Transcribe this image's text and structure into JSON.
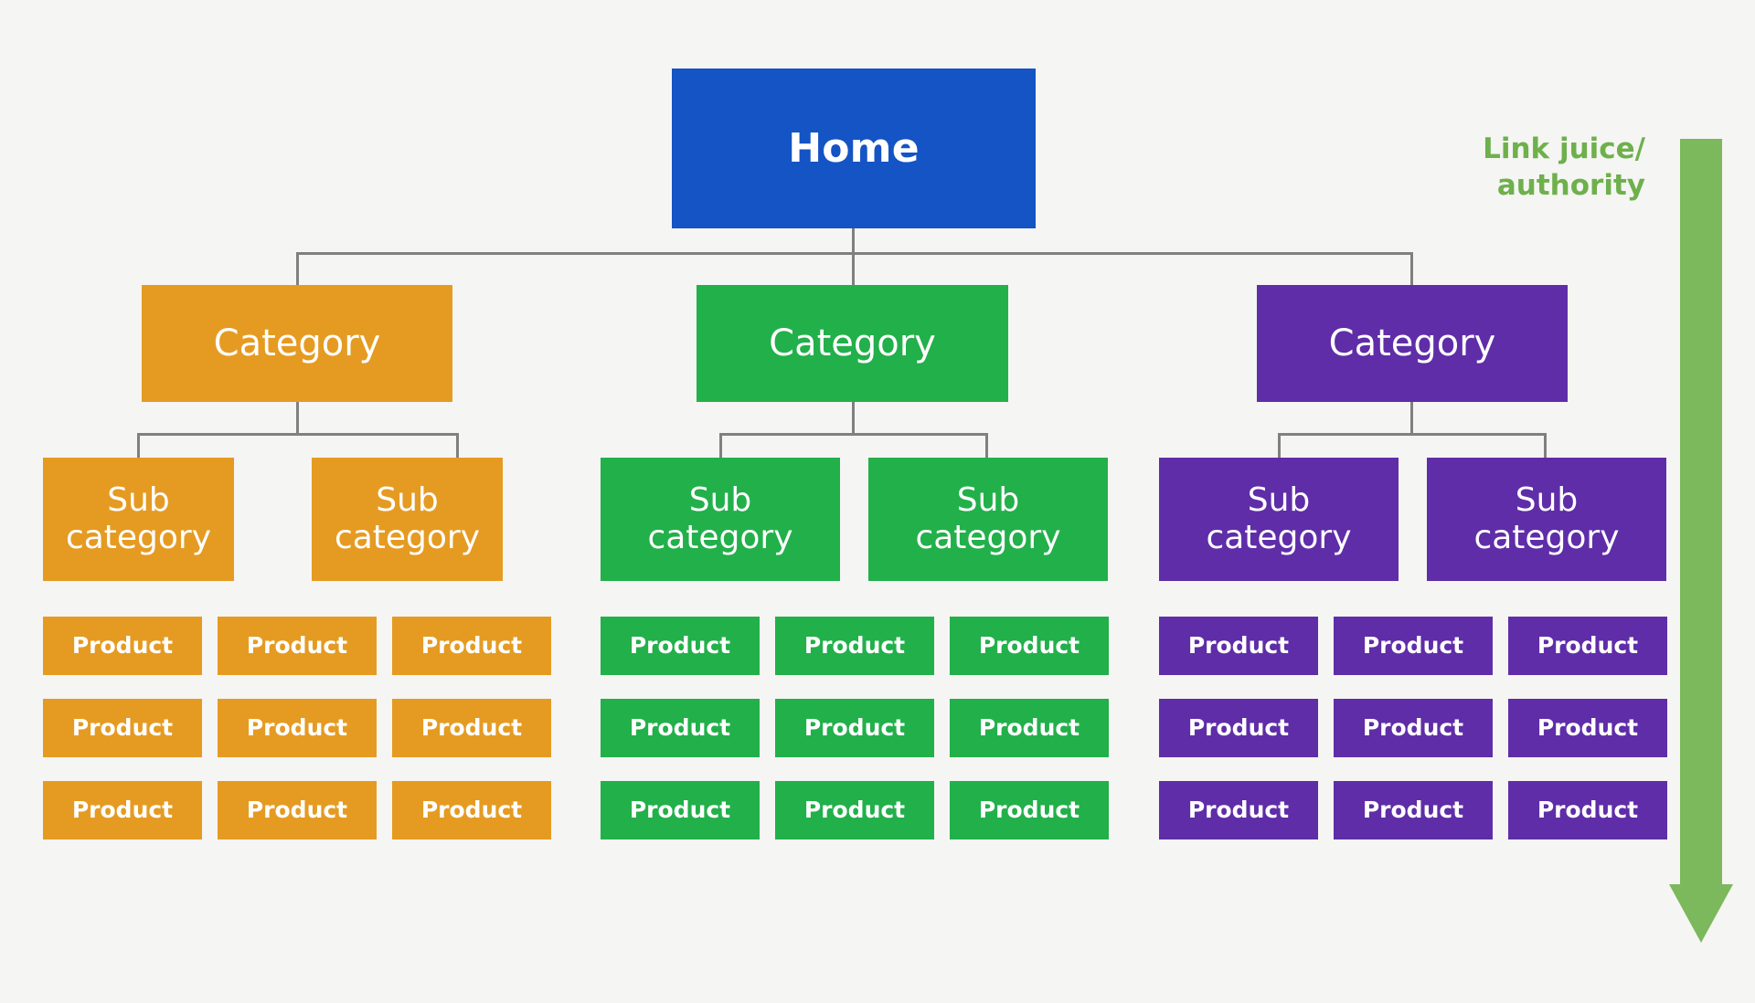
{
  "theme": {
    "background": "#f5f5f3",
    "connector_color": "#808080",
    "text_on_box": "#ffffff"
  },
  "diagram": {
    "title_node": {
      "label": "Home",
      "color": "#1454c4"
    },
    "annotation": {
      "label": "Link juice/\nauthority",
      "color": "#6eb04b",
      "arrow_color": "#7cb85c",
      "direction": "down"
    },
    "branches": [
      {
        "id": "branch-orange",
        "color": "#e59b22",
        "category": {
          "label": "Category"
        },
        "subcategories": [
          {
            "label": "Sub\ncategory"
          },
          {
            "label": "Sub\ncategory"
          }
        ],
        "products": [
          {
            "label": "Product"
          },
          {
            "label": "Product"
          },
          {
            "label": "Product"
          },
          {
            "label": "Product"
          },
          {
            "label": "Product"
          },
          {
            "label": "Product"
          },
          {
            "label": "Product"
          },
          {
            "label": "Product"
          },
          {
            "label": "Product"
          }
        ]
      },
      {
        "id": "branch-green",
        "color": "#22b04a",
        "category": {
          "label": "Category"
        },
        "subcategories": [
          {
            "label": "Sub\ncategory"
          },
          {
            "label": "Sub\ncategory"
          }
        ],
        "products": [
          {
            "label": "Product"
          },
          {
            "label": "Product"
          },
          {
            "label": "Product"
          },
          {
            "label": "Product"
          },
          {
            "label": "Product"
          },
          {
            "label": "Product"
          },
          {
            "label": "Product"
          },
          {
            "label": "Product"
          },
          {
            "label": "Product"
          }
        ]
      },
      {
        "id": "branch-purple",
        "color": "#5f2da8",
        "category": {
          "label": "Category"
        },
        "subcategories": [
          {
            "label": "Sub\ncategory"
          },
          {
            "label": "Sub\ncategory"
          }
        ],
        "products": [
          {
            "label": "Product"
          },
          {
            "label": "Product"
          },
          {
            "label": "Product"
          },
          {
            "label": "Product"
          },
          {
            "label": "Product"
          },
          {
            "label": "Product"
          },
          {
            "label": "Product"
          },
          {
            "label": "Product"
          },
          {
            "label": "Product"
          }
        ]
      }
    ]
  }
}
